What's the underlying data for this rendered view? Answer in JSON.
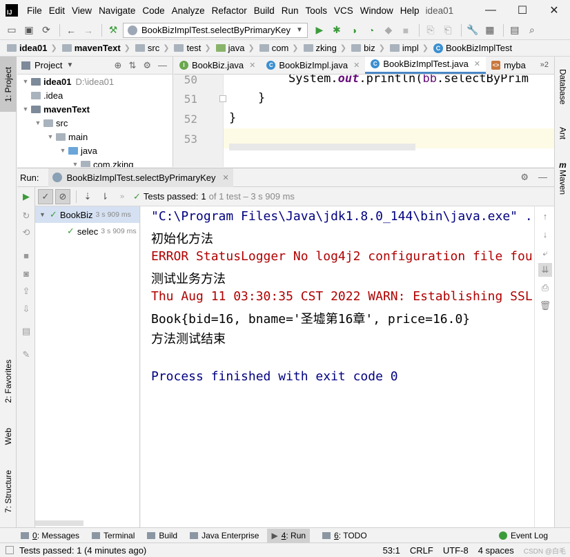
{
  "menubar": {
    "items": [
      "File",
      "Edit",
      "View",
      "Navigate",
      "Code",
      "Analyze",
      "Refactor",
      "Build",
      "Run",
      "Tools",
      "VCS",
      "Window",
      "Help"
    ],
    "project_name": "idea01",
    "minimize": "—",
    "maximize": "☐",
    "close": "✕"
  },
  "toolbar": {
    "run_config": "BookBizImplTest.selectByPrimaryKey"
  },
  "breadcrumb": [
    "idea01",
    "mavenText",
    "src",
    "test",
    "java",
    "com",
    "zking",
    "biz",
    "impl",
    "BookBizImplTest"
  ],
  "project_panel": {
    "title": "Project",
    "tree": [
      {
        "label": "idea01",
        "path": "D:\\idea01",
        "indent": 0
      },
      {
        "label": ".idea",
        "indent": 1
      },
      {
        "label": "mavenText",
        "indent": 1
      },
      {
        "label": "src",
        "indent": 2
      },
      {
        "label": "main",
        "indent": 3
      },
      {
        "label": "java",
        "indent": 4
      },
      {
        "label": "com.zking",
        "indent": 5
      }
    ]
  },
  "editor": {
    "tabs": [
      "BookBiz.java",
      "BookBizImpl.java",
      "BookBizImplTest.java",
      "myba"
    ],
    "overflow": "»2",
    "line_numbers": [
      "50",
      "51",
      "52",
      "53"
    ],
    "code_lines": {
      "l50_a": "System.",
      "l50_b": "out",
      "l50_c": ".println(",
      "l50_d": "bb",
      "l50_e": ".selectByPrim",
      "l51": "}",
      "l52": "}"
    }
  },
  "run_panel": {
    "label": "Run:",
    "tab": "BookBizImplTest.selectByPrimaryKey",
    "tests_passed_label": "Tests passed:",
    "tests_passed_value": "1",
    "tests_passed_detail": "of 1 test – 3 s 909 ms",
    "tree": [
      {
        "name": "BookBiz",
        "time": "3 s 909 ms"
      },
      {
        "name": "selec",
        "time": "3 s 909 ms"
      }
    ]
  },
  "console": {
    "lines": [
      "\"C:\\Program Files\\Java\\jdk1.8.0_144\\bin\\java.exe\" .",
      "初始化方法",
      "ERROR StatusLogger No log4j2 configuration file fou",
      "测试业务方法",
      "Thu Aug 11 03:30:35 CST 2022 WARN: Establishing SSL",
      "Book{bid=16, bname='圣墟第16章', price=16.0}",
      "方法测试结束",
      "",
      "Process finished with exit code 0"
    ]
  },
  "left_strip": {
    "project": "1: Project",
    "favorites": "2: Favorites",
    "web": "Web",
    "structure": "7: Structure"
  },
  "right_strip": {
    "database": "Database",
    "ant": "Ant",
    "maven": "Maven",
    "maven_icon": "m"
  },
  "bottom_tools": {
    "messages_u": "0",
    "messages": ": Messages",
    "terminal": "Terminal",
    "build": "Build",
    "java_enterprise": "Java Enterprise",
    "run_u": "4",
    "run": ": Run",
    "todo_u": "6",
    "todo": ": TODO",
    "event_log": "Event Log"
  },
  "status": {
    "message": "Tests passed: 1 (4 minutes ago)",
    "position": "53:1",
    "line_sep": "CRLF",
    "encoding": "UTF-8",
    "indent": "4 spaces",
    "watermark": "CSDN @白毛"
  }
}
